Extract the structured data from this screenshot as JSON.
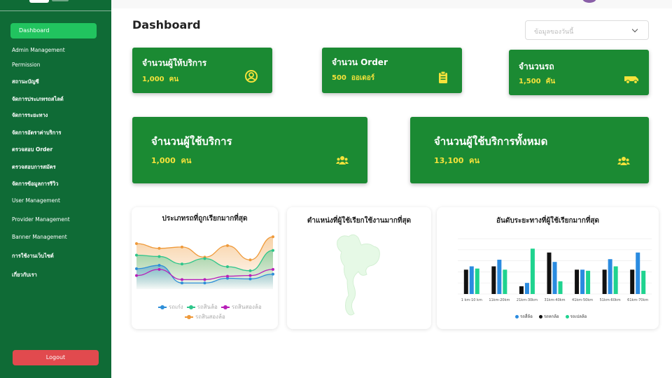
{
  "sidebar": {
    "active": "Dashboard",
    "items": [
      {
        "label": "Admin Management",
        "bold": false
      },
      {
        "label": "Permission",
        "bold": false
      },
      {
        "label": "สถานะบัญชี",
        "bold": true
      },
      {
        "label": "จัดการประเภทรถสไลด์",
        "bold": true
      },
      {
        "label": "จัดการระยะทาง",
        "bold": true
      },
      {
        "label": "จัดการอัตราค่าบริการ",
        "bold": true
      },
      {
        "label": "ตรวจสอบ Order",
        "bold": true
      },
      {
        "label": "ตรวจสอบการสมัคร",
        "bold": true
      },
      {
        "label": "จัดการข้อมูลการรีวิว",
        "bold": true
      },
      {
        "label": "User Management",
        "bold": false
      },
      {
        "label": "Provider Management",
        "bold": false
      },
      {
        "label": "Banner Management",
        "bold": false
      },
      {
        "label": "การใช้งานเว็บไซต์",
        "bold": true
      },
      {
        "label": "เกี่ยวกับเรา",
        "bold": true
      }
    ],
    "logout": "Logout"
  },
  "page": {
    "title": "Dashboard",
    "date_select_placeholder": "ข้อมูลของวันนี้"
  },
  "cards": {
    "providers": {
      "title": "จำนวนผู้ให้บริการ",
      "value": "1,000",
      "unit": "คน",
      "icon": "user-circle-icon"
    },
    "orders": {
      "title": "จำนวน Order",
      "value": "500",
      "unit": "ออเดอร์",
      "icon": "clipboard-icon"
    },
    "cars": {
      "title": "จำนวนรถ",
      "value": "1,500",
      "unit": "คัน",
      "icon": "truck-icon"
    },
    "users": {
      "title": "จำนวนผู้ใช้บริการ",
      "value": "1,000",
      "unit": "คน",
      "icon": "users-icon"
    },
    "users_total": {
      "title": "จำนวนผู้ใช้บริการทั้งหมด",
      "value": "13,100",
      "unit": "คน",
      "icon": "users-icon"
    }
  },
  "colors": {
    "sidebar": "#0f6b36",
    "accent": "#21c45f",
    "card": "#1b8a33",
    "value": "#f5e23b",
    "logout": "#e14a4e"
  },
  "panels": {
    "map_title": "ตำแหน่งที่ผู้ใช้เรียกใช้งานมากที่สุด"
  },
  "chart_data": [
    {
      "type": "area",
      "title": "ประเภทรถที่ถูกเรียกมากที่สุด",
      "ylim": [
        0,
        100
      ],
      "grid": false,
      "legend_position": "bottom",
      "series": [
        {
          "name": "รถเก๋ง",
          "color": "#2e8ed8",
          "values": [
            30,
            35,
            9,
            9,
            16,
            15,
            22
          ]
        },
        {
          "name": "รถสินล้อ",
          "color": "#2ec58a",
          "values": [
            50,
            48,
            37,
            45,
            33,
            27,
            57
          ]
        },
        {
          "name": "รถสินสองล้อ",
          "color": "#b81fb8",
          "values": [
            20,
            29,
            14,
            14,
            19,
            20,
            29
          ]
        },
        {
          "name": "รถสินสองล้อ",
          "color": "#ef9a3a",
          "values": [
            67,
            60,
            62,
            47,
            64,
            43,
            77
          ]
        }
      ]
    },
    {
      "type": "bar",
      "title": "อันดับระยะทางที่ผู้ใช้เรียกมากที่สุด",
      "categories": [
        "1 km-10 km",
        "11km-20km",
        "21km-30km",
        "31km-40km",
        "41km-50km",
        "51km-60km",
        "61km-70km"
      ],
      "ylim": [
        0,
        100
      ],
      "grid": true,
      "legend_position": "bottom",
      "series": [
        {
          "name": "รถสี่ล้อ",
          "color": "#2a8be0",
          "values": [
            50,
            62,
            20,
            58,
            44,
            63,
            75
          ]
        },
        {
          "name": "รถหกล้อ",
          "color": "#111111",
          "values": [
            44,
            50,
            14,
            75,
            44,
            44,
            44
          ]
        },
        {
          "name": "รถเปลล้อ",
          "color": "#1fd38f",
          "values": [
            46,
            44,
            82,
            23,
            42,
            50,
            42
          ]
        }
      ]
    }
  ]
}
